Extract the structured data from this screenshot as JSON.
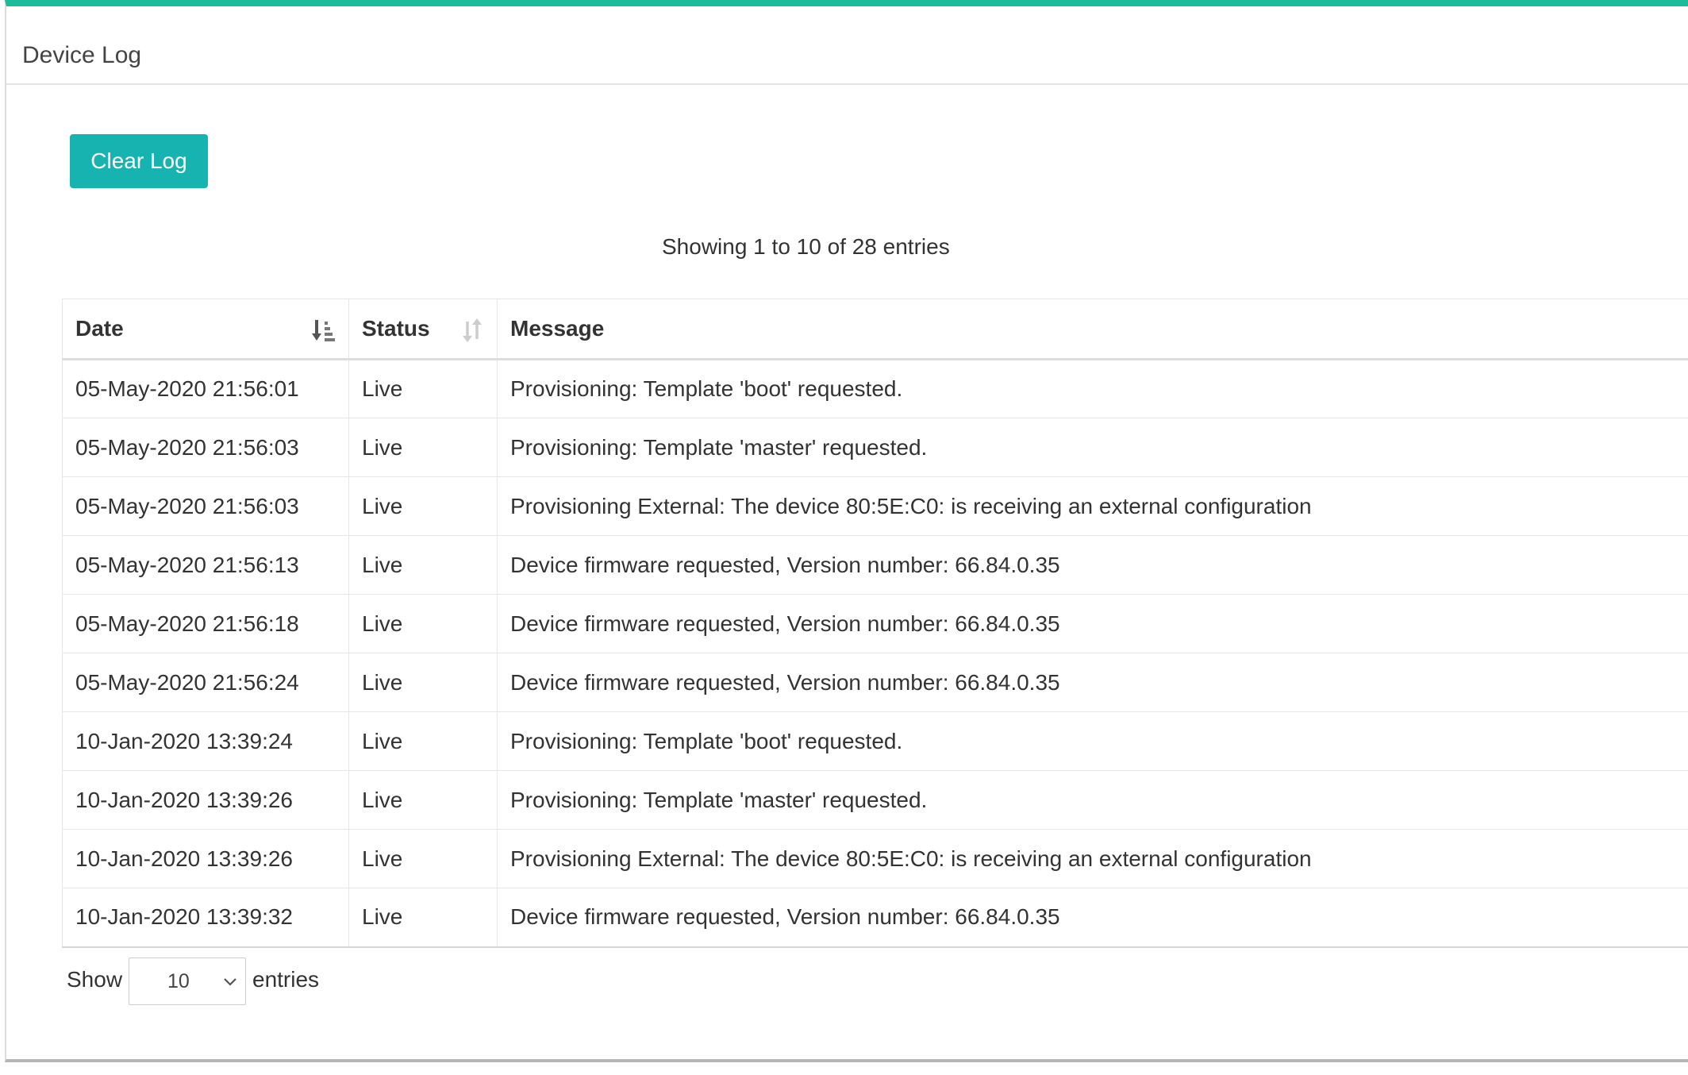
{
  "panel": {
    "title": "Device Log"
  },
  "toolbar": {
    "clear_label": "Clear Log"
  },
  "table_info": "Showing 1 to 10 of 28 entries",
  "table": {
    "columns": [
      "Date",
      "Status",
      "Message"
    ],
    "rows": [
      {
        "date": "05-May-2020 21:56:01",
        "status": "Live",
        "message": "Provisioning: Template 'boot' requested."
      },
      {
        "date": "05-May-2020 21:56:03",
        "status": "Live",
        "message": "Provisioning: Template 'master' requested."
      },
      {
        "date": "05-May-2020 21:56:03",
        "status": "Live",
        "message": "Provisioning External: The device 80:5E:C0:  is receiving an external configuration"
      },
      {
        "date": "05-May-2020 21:56:13",
        "status": "Live",
        "message": "Device firmware requested, Version number: 66.84.0.35"
      },
      {
        "date": "05-May-2020 21:56:18",
        "status": "Live",
        "message": "Device firmware requested, Version number: 66.84.0.35"
      },
      {
        "date": "05-May-2020 21:56:24",
        "status": "Live",
        "message": "Device firmware requested, Version number: 66.84.0.35"
      },
      {
        "date": "10-Jan-2020 13:39:24",
        "status": "Live",
        "message": "Provisioning: Template 'boot' requested."
      },
      {
        "date": "10-Jan-2020 13:39:26",
        "status": "Live",
        "message": "Provisioning: Template 'master' requested."
      },
      {
        "date": "10-Jan-2020 13:39:26",
        "status": "Live",
        "message": "Provisioning External: The device 80:5E:C0:  is receiving an external configuration"
      },
      {
        "date": "10-Jan-2020 13:39:32",
        "status": "Live",
        "message": "Device firmware requested, Version number: 66.84.0.35"
      }
    ]
  },
  "length_menu": {
    "show_label": "Show",
    "selected": "10",
    "entries_label": "entries"
  },
  "colors": {
    "accent": "#1abc9c",
    "button": "#17b3b0"
  },
  "icons": {
    "date_sort": "sort-ascending-icon",
    "status_sort": "sort-both-icon",
    "length_select": "chevron-down-icon"
  }
}
